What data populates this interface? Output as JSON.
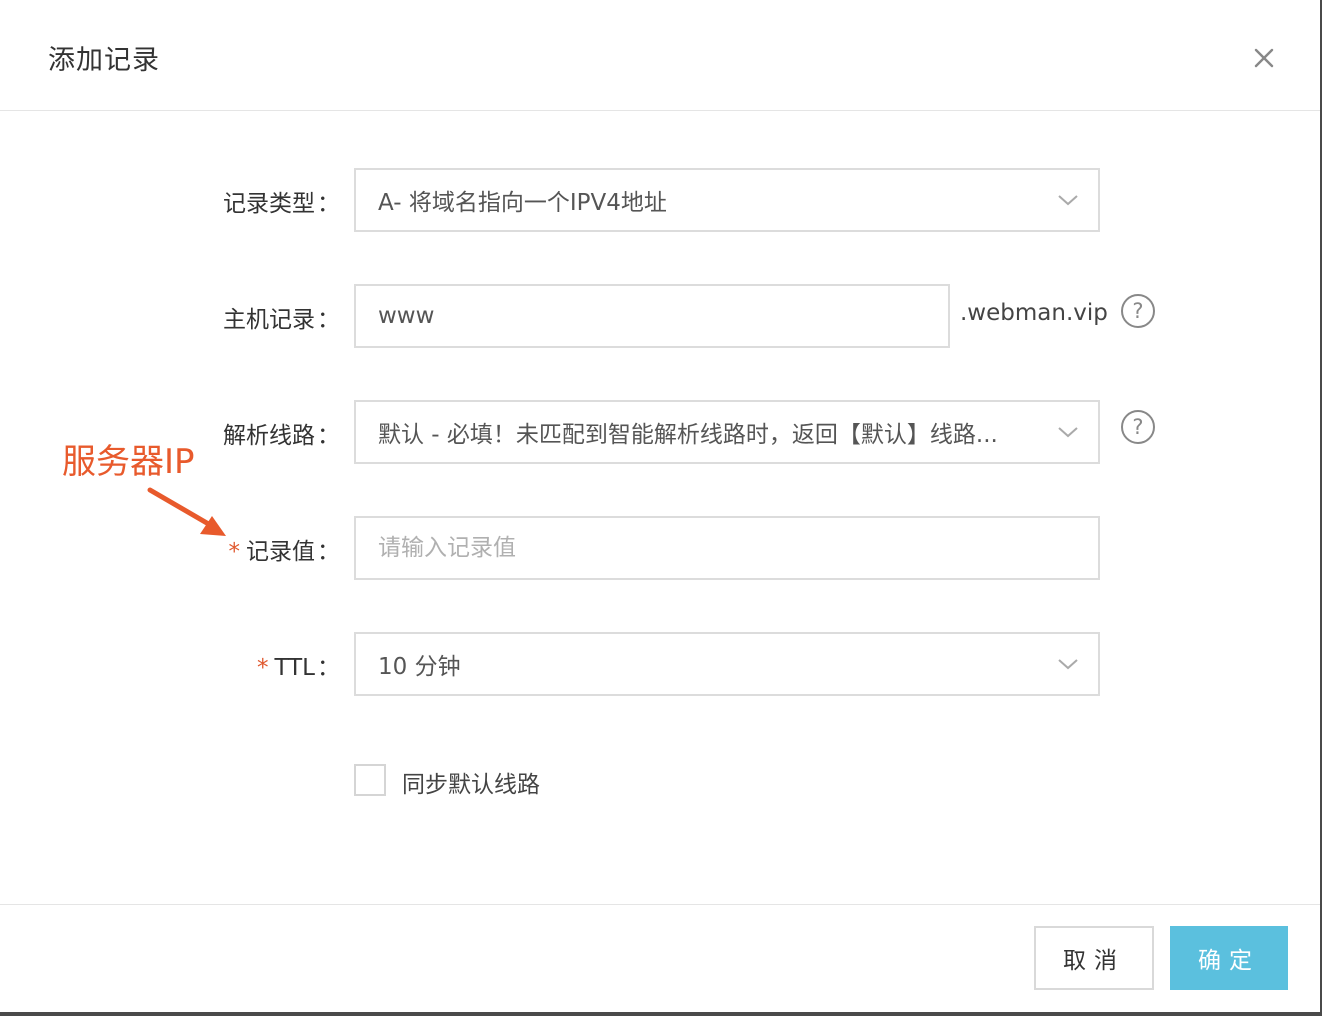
{
  "dialog": {
    "title": "添加记录",
    "close_icon": "close-icon"
  },
  "form": {
    "record_type": {
      "label": "记录类型",
      "value": "A- 将域名指向一个IPV4地址"
    },
    "host": {
      "label": "主机记录",
      "value": "www",
      "suffix": ".webman.vip"
    },
    "line": {
      "label": "解析线路",
      "value": "默认 - 必填！未匹配到智能解析线路时，返回【默认】线路..."
    },
    "record_value": {
      "required_mark": "*",
      "label": "记录值",
      "placeholder": "请输入记录值"
    },
    "ttl": {
      "required_mark": "*",
      "label": "TTL",
      "value": "10 分钟"
    },
    "sync_default_line": {
      "label": "同步默认线路",
      "checked": false
    },
    "colon": "："
  },
  "annotation": {
    "text": "服务器IP",
    "color": "#e85a2c"
  },
  "footer": {
    "cancel_label": "取消",
    "ok_label": "确定",
    "ok_color": "#5bc0de"
  }
}
